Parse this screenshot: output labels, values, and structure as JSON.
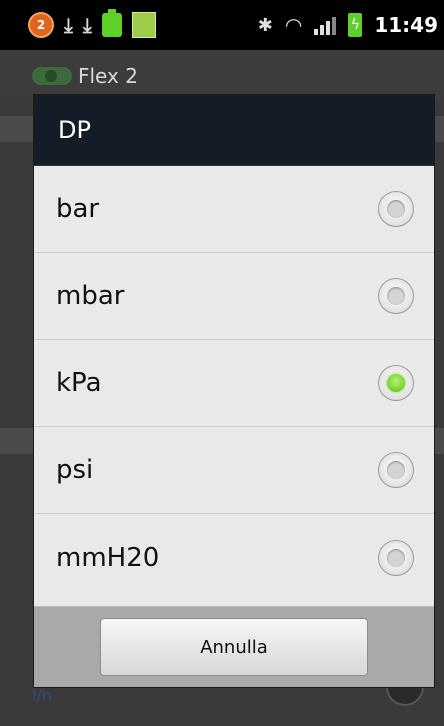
{
  "status_bar": {
    "notification_count": "2",
    "time": "11:49",
    "icons": [
      "notification-badge-icon",
      "download-icon",
      "download-icon",
      "battery-app-icon",
      "calendar-app-icon",
      "bluetooth-icon",
      "wifi-icon",
      "signal-icon",
      "battery-charging-icon"
    ]
  },
  "app_bar": {
    "title": "Flex 2"
  },
  "background": {
    "unit_label": "l/h"
  },
  "dialog": {
    "title": "DP",
    "options": [
      {
        "label": "bar",
        "selected": false
      },
      {
        "label": "mbar",
        "selected": false
      },
      {
        "label": "kPa",
        "selected": true
      },
      {
        "label": "psi",
        "selected": false
      },
      {
        "label": "mmH20",
        "selected": false
      }
    ],
    "cancel_label": "Annulla"
  },
  "colors": {
    "dialog_header": "#141c25",
    "dialog_body": "#e9e9e9",
    "radio_checked": "#7fd83a"
  }
}
